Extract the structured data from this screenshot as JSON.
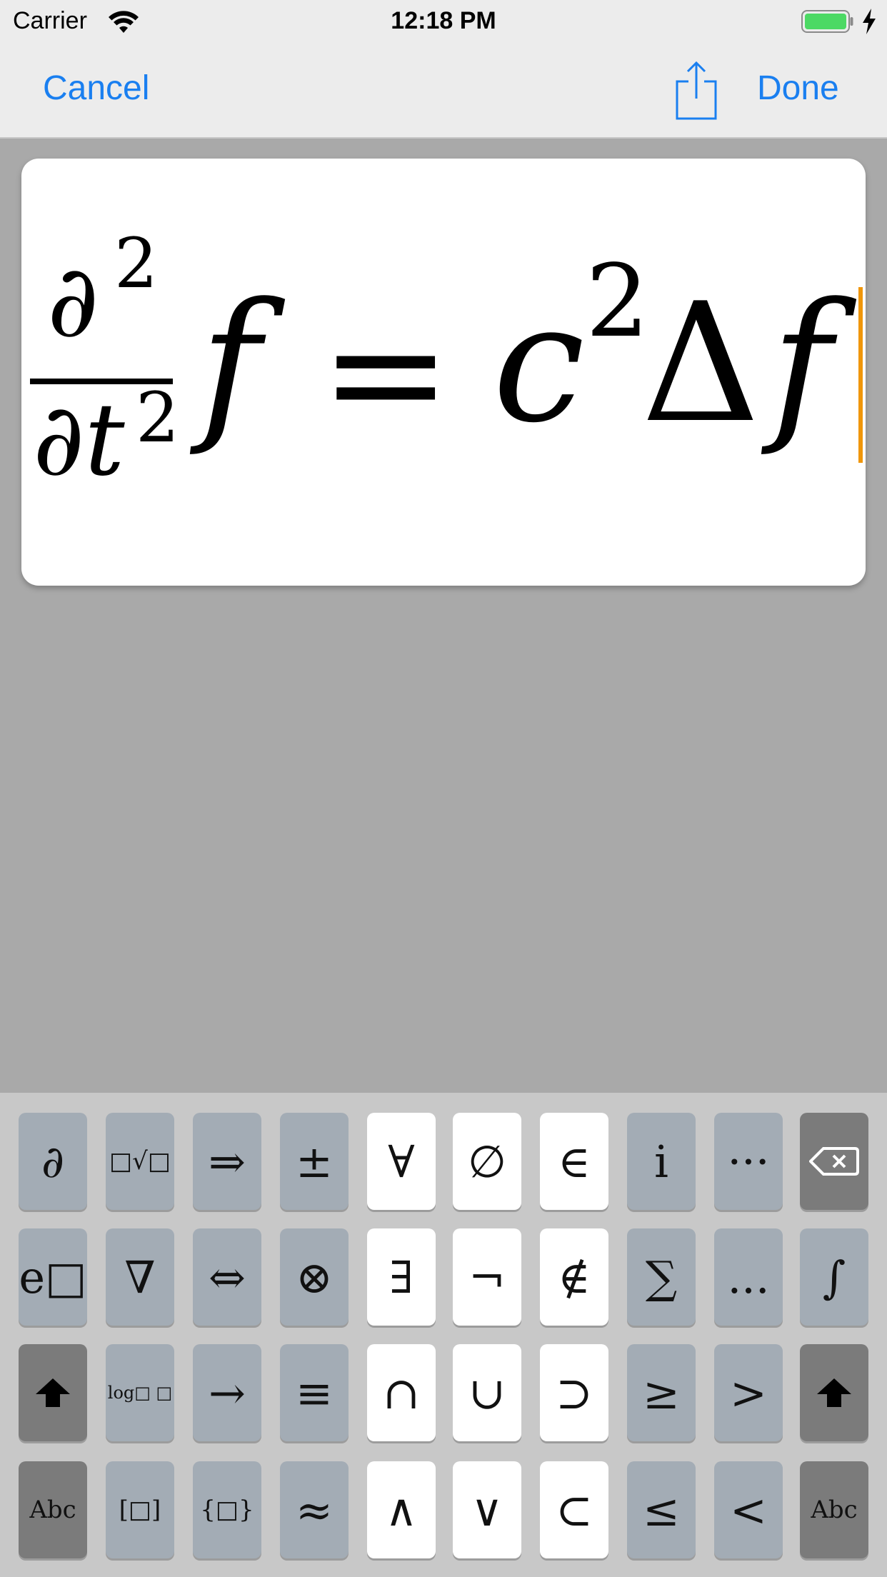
{
  "status_bar": {
    "carrier": "Carrier",
    "time": "12:18 PM",
    "icons": [
      "wifi-icon",
      "battery-icon",
      "charging-bolt-icon"
    ]
  },
  "nav": {
    "cancel_label": "Cancel",
    "done_label": "Done",
    "share_icon": "share-icon"
  },
  "editor": {
    "formula_latex": "\\frac{\\partial^2}{\\partial t^2} f = c^2 \\Delta f",
    "parts": {
      "num_symbol": "∂",
      "num_exp": "2",
      "den_symbol": "∂t",
      "den_exp": "2",
      "f1": "f",
      "equals": "=",
      "c": "c",
      "c_exp": "2",
      "delta": "Δ",
      "f2": "f"
    },
    "cursor_color": "#f0960a"
  },
  "keyboard": {
    "rows": [
      [
        {
          "label": "∂",
          "name": "partial-key",
          "style": "gray"
        },
        {
          "label": "□√□",
          "name": "nth-root-key",
          "style": "gray"
        },
        {
          "label": "⇒",
          "name": "implies-key",
          "style": "gray"
        },
        {
          "label": "±",
          "name": "plus-minus-key",
          "style": "gray"
        },
        {
          "label": "∀",
          "name": "for-all-key",
          "style": "white"
        },
        {
          "label": "∅",
          "name": "empty-set-key",
          "style": "white"
        },
        {
          "label": "∈",
          "name": "element-of-key",
          "style": "white"
        },
        {
          "label": "i",
          "name": "imaginary-i-key",
          "style": "gray"
        },
        {
          "label": "···",
          "name": "center-dots-key",
          "style": "gray"
        },
        {
          "label": "",
          "name": "backspace-key",
          "style": "dark",
          "icon": "backspace-icon"
        }
      ],
      [
        {
          "label": "e□",
          "name": "exponent-key",
          "style": "gray"
        },
        {
          "label": "∇",
          "name": "nabla-key",
          "style": "gray"
        },
        {
          "label": "⇔",
          "name": "iff-key",
          "style": "gray"
        },
        {
          "label": "⊗",
          "name": "tensor-key",
          "style": "gray"
        },
        {
          "label": "∃",
          "name": "exists-key",
          "style": "white"
        },
        {
          "label": "¬",
          "name": "not-key",
          "style": "white"
        },
        {
          "label": "∉",
          "name": "not-element-key",
          "style": "white"
        },
        {
          "label": "∑",
          "name": "sum-key",
          "style": "gray"
        },
        {
          "label": "...",
          "name": "low-dots-key",
          "style": "gray"
        },
        {
          "label": "∫",
          "name": "integral-key",
          "style": "gray"
        }
      ],
      [
        {
          "label": "",
          "name": "shift-left-key",
          "style": "dark",
          "icon": "shift-arrow-icon"
        },
        {
          "label": "log□ □",
          "name": "log-key",
          "style": "gray"
        },
        {
          "label": "→",
          "name": "right-arrow-key",
          "style": "gray"
        },
        {
          "label": "≡",
          "name": "equivalent-key",
          "style": "gray"
        },
        {
          "label": "∩",
          "name": "intersection-key",
          "style": "white"
        },
        {
          "label": "∪",
          "name": "union-key",
          "style": "white"
        },
        {
          "label": "⊃",
          "name": "superset-key",
          "style": "white"
        },
        {
          "label": "≥",
          "name": "greater-equal-key",
          "style": "gray"
        },
        {
          "label": ">",
          "name": "greater-key",
          "style": "gray"
        },
        {
          "label": "",
          "name": "shift-right-key",
          "style": "dark",
          "icon": "shift-arrow-icon"
        }
      ],
      [
        {
          "label": "Abc",
          "name": "abc-left-key",
          "style": "dark"
        },
        {
          "label": "[□]",
          "name": "brackets-key",
          "style": "gray"
        },
        {
          "label": "{□}",
          "name": "braces-key",
          "style": "gray"
        },
        {
          "label": "≈",
          "name": "approx-key",
          "style": "gray"
        },
        {
          "label": "∧",
          "name": "and-key",
          "style": "white"
        },
        {
          "label": "∨",
          "name": "or-key",
          "style": "white"
        },
        {
          "label": "⊂",
          "name": "subset-key",
          "style": "white"
        },
        {
          "label": "≤",
          "name": "less-equal-key",
          "style": "gray"
        },
        {
          "label": "<",
          "name": "less-key",
          "style": "gray"
        },
        {
          "label": "Abc",
          "name": "abc-right-key",
          "style": "dark"
        }
      ]
    ]
  }
}
